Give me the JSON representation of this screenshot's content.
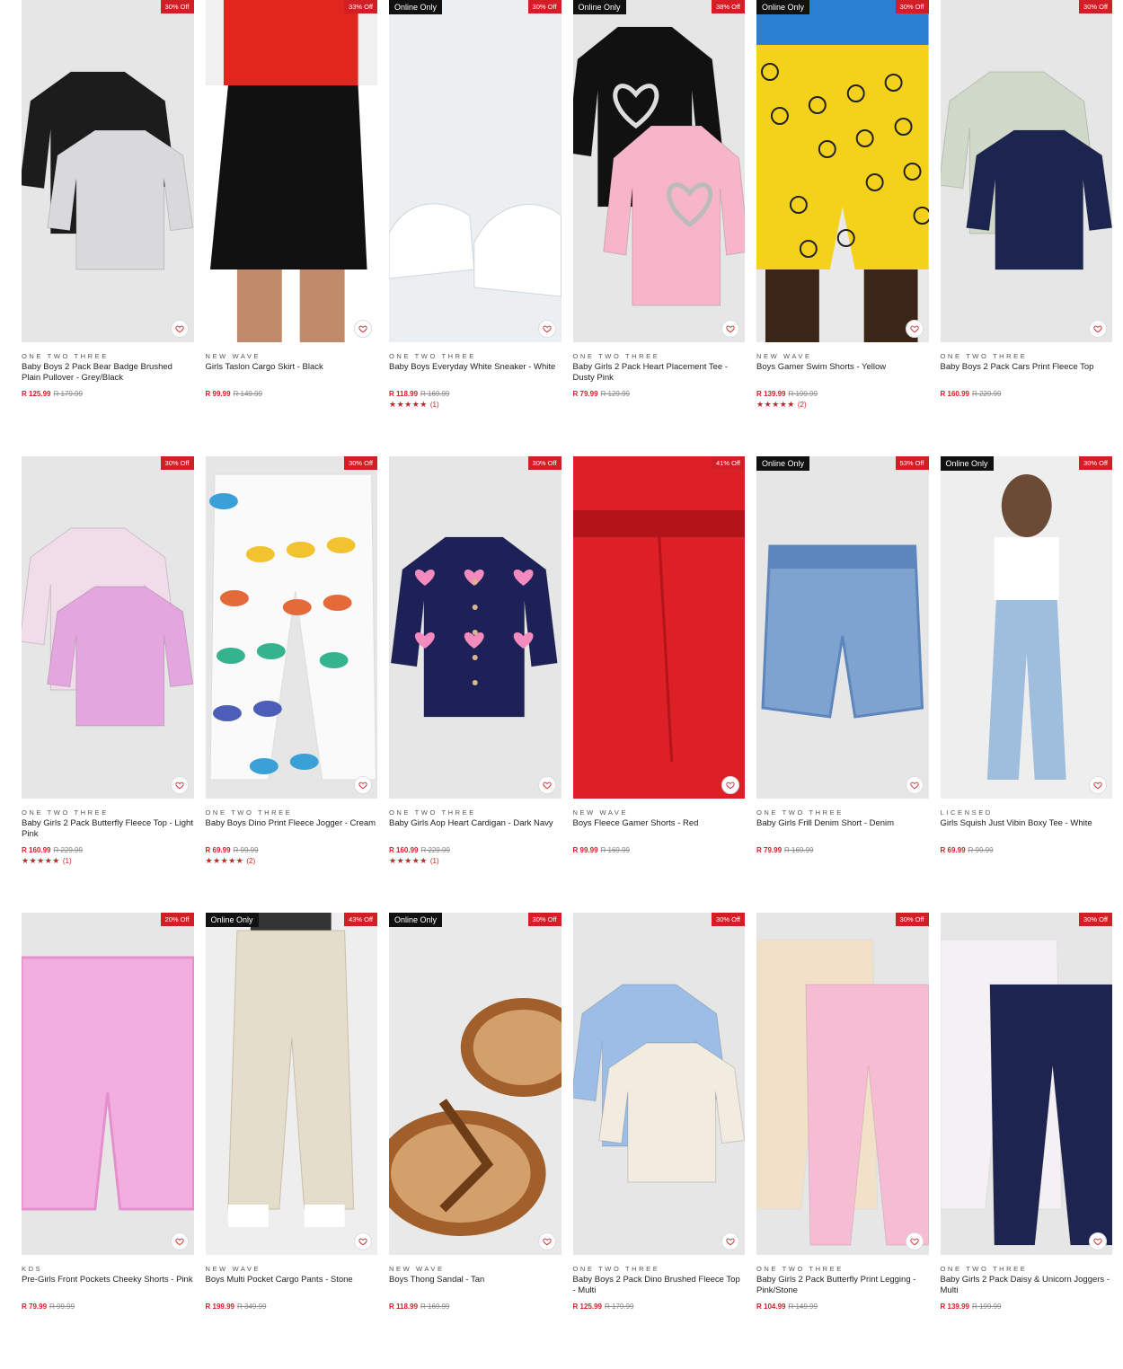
{
  "products": [
    {
      "brand": "ONE TWO THREE",
      "title": "Baby Boys 2 Pack Bear Badge Brushed Plain Pullover - Grey/Black",
      "price": "R 125.99",
      "was": "R 179.99",
      "discount": "30% Off",
      "online": "",
      "rating": "",
      "reviews": "",
      "bg": "#e6e6e6",
      "art": "sweaters2",
      "c1": "#1c1c1c",
      "c2": "#d9d9dc"
    },
    {
      "brand": "NEW WAVE",
      "title": "Girls Taslon Cargo Skirt - Black",
      "price": "R 99.99",
      "was": "R 149.99",
      "discount": "33% Off",
      "online": "",
      "rating": "",
      "reviews": "",
      "bg": "#f0f0f0",
      "art": "skirt",
      "c1": "#111111",
      "c2": "#e0261d"
    },
    {
      "brand": "ONE TWO THREE",
      "title": "Baby Boys Everyday White Sneaker - White",
      "price": "R 118.99",
      "was": "R 169.99",
      "discount": "30% Off",
      "online": "Online Only",
      "rating": "★★★★★",
      "reviews": "(1)",
      "bg": "#eceff1",
      "art": "sneakers",
      "c1": "#ffffff",
      "c2": "#cfd6dc"
    },
    {
      "brand": "ONE TWO THREE",
      "title": "Baby Girls 2 Pack Heart Placement Tee - Dusty Pink",
      "price": "R 79.99",
      "was": "R 129.99",
      "discount": "38% Off",
      "online": "Online Only",
      "rating": "",
      "reviews": "",
      "bg": "#e6e6e6",
      "art": "tees2",
      "c1": "#111111",
      "c2": "#f6b5c8"
    },
    {
      "brand": "NEW WAVE",
      "title": "Boys Gamer Swim Shorts - Yellow",
      "price": "R 139.99",
      "was": "R 199.99",
      "discount": "30% Off",
      "online": "Online Only",
      "rating": "★★★★★",
      "reviews": "(2)",
      "bg": "#e9e9e9",
      "art": "shorts-yellow",
      "c1": "#f4d21b",
      "c2": "#2b7fd0"
    },
    {
      "brand": "ONE TWO THREE",
      "title": "Baby Boys 2 Pack Cars Print Fleece Top",
      "price": "R 160.99",
      "was": "R 229.99",
      "discount": "30% Off",
      "online": "",
      "rating": "",
      "reviews": "",
      "bg": "#e6e6e6",
      "art": "sweaters2",
      "c1": "#cfd8c9",
      "c2": "#1c2450"
    },
    {
      "brand": "ONE TWO THREE",
      "title": "Baby Girls 2 Pack Butterfly Fleece Top - Light Pink",
      "price": "R 160.99",
      "was": "R 229.99",
      "discount": "30% Off",
      "online": "",
      "rating": "★★★★★",
      "reviews": "(1)",
      "bg": "#e6e6e6",
      "art": "sweaters2",
      "c1": "#f1dce9",
      "c2": "#e3a6de"
    },
    {
      "brand": "ONE TWO THREE",
      "title": "Baby Boys Dino Print Fleece Jogger - Cream",
      "price": "R 69.99",
      "was": "R 99.99",
      "discount": "30% Off",
      "online": "",
      "rating": "★★★★★",
      "reviews": "(2)",
      "bg": "#e6e6e6",
      "art": "joggers1",
      "c1": "#fafafa",
      "c2": "#3aa0d8"
    },
    {
      "brand": "ONE TWO THREE",
      "title": "Baby Girls Aop Heart Cardigan - Dark Navy",
      "price": "R 160.99",
      "was": "R 229.99",
      "discount": "30% Off",
      "online": "",
      "rating": "★★★★★",
      "reviews": "(1)",
      "bg": "#e6e6e6",
      "art": "cardigan",
      "c1": "#1d2157",
      "c2": "#f48bbf"
    },
    {
      "brand": "NEW WAVE",
      "title": "Boys Fleece Gamer Shorts - Red",
      "price": "R 99.99",
      "was": "R 169.99",
      "discount": "41% Off",
      "online": "",
      "rating": "",
      "reviews": "",
      "bg": "#e8e8e8",
      "art": "shorts-red",
      "c1": "#dd1f26",
      "c2": "#b3141a"
    },
    {
      "brand": "ONE TWO THREE",
      "title": "Baby Girls Frill Denim Short - Denim",
      "price": "R 79.99",
      "was": "R 169.99",
      "discount": "53% Off",
      "online": "Online Only",
      "rating": "",
      "reviews": "",
      "bg": "#e6e6e6",
      "art": "denim-short",
      "c1": "#7fa3cf",
      "c2": "#5d86bd"
    },
    {
      "brand": "LICENSED",
      "title": "Girls Squish Just Vibin Boxy Tee - White",
      "price": "R 69.99",
      "was": "R 99.99",
      "discount": "30% Off",
      "online": "Online Only",
      "rating": "",
      "reviews": "",
      "bg": "#eeeeee",
      "art": "model-jeans",
      "c1": "#ffffff",
      "c2": "#9fbddc"
    },
    {
      "brand": "KDS",
      "title": "Pre-Girls Front Pockets Cheeky Shorts - Pink",
      "price": "R 79.99",
      "was": "R 99.99",
      "discount": "20% Off",
      "online": "",
      "rating": "",
      "reviews": "",
      "bg": "#e6e6e6",
      "art": "pink-shorts",
      "c1": "#f3aee0",
      "c2": "#e390cc"
    },
    {
      "brand": "NEW WAVE",
      "title": "Boys Multi Pocket Cargo Pants - Stone",
      "price": "R 199.99",
      "was": "R 349.99",
      "discount": "43% Off",
      "online": "Online Only",
      "rating": "",
      "reviews": "",
      "bg": "#eeeeee",
      "art": "cargo",
      "c1": "#e4ddcc",
      "c2": "#ffffff"
    },
    {
      "brand": "NEW WAVE",
      "title": "Boys Thong Sandal - Tan",
      "price": "R 118.99",
      "was": "R 169.99",
      "discount": "30% Off",
      "online": "Online Only",
      "rating": "",
      "reviews": "",
      "bg": "#e9e9e9",
      "art": "sandals",
      "c1": "#a15f2b",
      "c2": "#d3a06b"
    },
    {
      "brand": "ONE TWO THREE",
      "title": "Baby Boys 2 Pack Dino Brushed Fleece Top - Multi",
      "price": "R 125.99",
      "was": "R 179.99",
      "discount": "30% Off",
      "online": "",
      "rating": "",
      "reviews": "",
      "bg": "#e6e6e6",
      "art": "sweaters2",
      "c1": "#9bbde6",
      "c2": "#f2ece0"
    },
    {
      "brand": "ONE TWO THREE",
      "title": "Baby Girls 2 Pack Butterfly Print Legging - Pink/Stone",
      "price": "R 104.99",
      "was": "R 149.99",
      "discount": "30% Off",
      "online": "",
      "rating": "",
      "reviews": "",
      "bg": "#e6e6e6",
      "art": "leggings2",
      "c1": "#f1e1c9",
      "c2": "#f6bcd4"
    },
    {
      "brand": "ONE TWO THREE",
      "title": "Baby Girls 2 Pack Daisy & Unicorn Joggers - Multi",
      "price": "R 139.99",
      "was": "R 199.99",
      "discount": "30% Off",
      "online": "",
      "rating": "",
      "reviews": "",
      "bg": "#e6e6e6",
      "art": "leggings2",
      "c1": "#f4f0f4",
      "c2": "#1e2450"
    }
  ],
  "icons": {
    "wishlist": "heart-outline-icon",
    "rating": "star-icon"
  },
  "colors": {
    "accent": "#d21f26",
    "badge": "#111111"
  }
}
